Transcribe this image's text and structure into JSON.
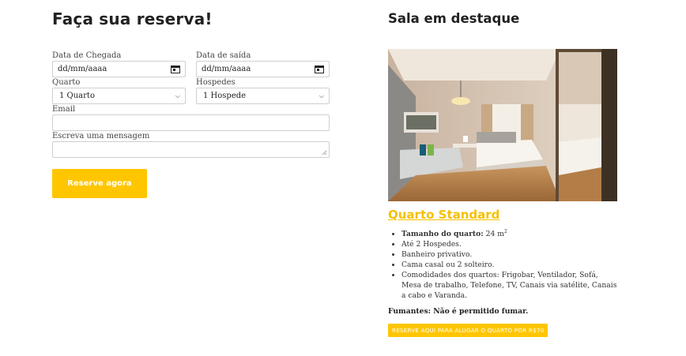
{
  "form": {
    "title": "Faça sua reserva!",
    "arrival_label": "Data de Chegada",
    "arrival_placeholder": "dd/mm/aaaa",
    "departure_label": "Data de saída",
    "departure_placeholder": "dd/mm/aaaa",
    "room_label": "Quarto",
    "room_value": "1 Quarto",
    "guests_label": "Hospedes",
    "guests_value": "1 Hospede",
    "email_label": "Email",
    "message_label": "Escreva uma mensagem",
    "submit_label": "Reserve agora"
  },
  "featured": {
    "title": "Sala em destaque",
    "room_name": "Quarto Standard",
    "size_label": "Tamanho do quarto:",
    "size_value": "24 m",
    "size_sup": "2",
    "features": [
      "Até 2 Hospedes.",
      "Banheiro privativo.",
      "Cama casal ou 2 solteiro.",
      "Comodidades dos quartos: Frigobar, Ventilador, Sofá, Mesa de trabalho, Telefone, TV, Canais via satélite, Canais a cabo e Varanda."
    ],
    "smoking_note": "Fumantes: Não é permitido fumar.",
    "rent_button": "RESERVE AQUI PARA ALUGAR O QUARTO POR R$70"
  },
  "colors": {
    "accent": "#ffc600",
    "title_link": "#f5c000"
  }
}
